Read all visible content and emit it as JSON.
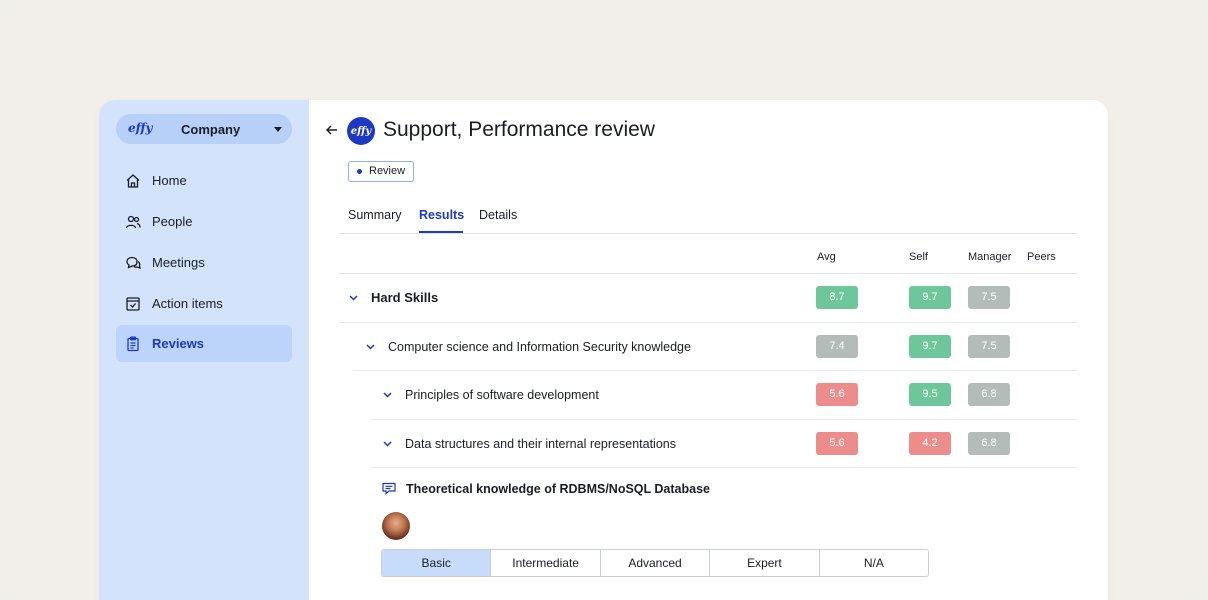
{
  "sidebar": {
    "logo": "effy",
    "company": "Company",
    "items": [
      {
        "label": "Home",
        "icon": "home-icon"
      },
      {
        "label": "People",
        "icon": "people-icon"
      },
      {
        "label": "Meetings",
        "icon": "chat-bubbles-icon"
      },
      {
        "label": "Action items",
        "icon": "checkbox-icon"
      },
      {
        "label": "Reviews",
        "icon": "clipboard-icon",
        "active": true
      }
    ]
  },
  "header": {
    "logo": "effy",
    "title": "Support, Performance review",
    "badge": "Review"
  },
  "tabs": [
    {
      "label": "Summary"
    },
    {
      "label": "Results",
      "active": true
    },
    {
      "label": "Details"
    }
  ],
  "columns": [
    "Avg",
    "Self",
    "Manager",
    "Peers"
  ],
  "rows": [
    {
      "label": "Hard Skills",
      "avg": "8.7",
      "self": "9.7",
      "manager": "7.5"
    },
    {
      "label": "Computer science and Information Security knowledge",
      "avg": "7.4",
      "self": "9.7",
      "manager": "7.5"
    },
    {
      "label": "Principles of software development",
      "avg": "5.6",
      "self": "9.5",
      "manager": "6.8"
    },
    {
      "label": "Data structures and their internal representations",
      "avg": "5.6",
      "self": "4.2",
      "manager": "6.8"
    }
  ],
  "question": {
    "label": "Theoretical knowledge of RDBMS/NoSQL Database",
    "levels": [
      "Basic",
      "Intermediate",
      "Advanced",
      "Expert",
      "N/A"
    ],
    "selected": "Basic"
  },
  "colors": {
    "brand": "#1d39c4",
    "sidebar_bg": "#d3e3fc",
    "score_green": "#6dc79a",
    "score_gray": "#b3bcb8",
    "score_red": "#ec8d8b"
  }
}
